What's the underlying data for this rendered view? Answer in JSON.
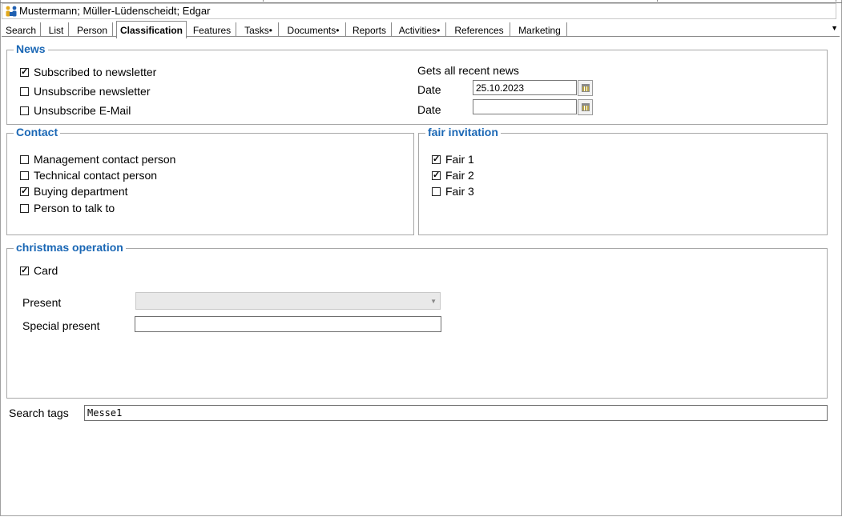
{
  "window": {
    "title": "Mustermann; Müller-Lüdenscheidt; Edgar"
  },
  "tabs": [
    {
      "label": "Search"
    },
    {
      "label": "List"
    },
    {
      "label": "Person"
    },
    {
      "label": "Classification"
    },
    {
      "label": "Features"
    },
    {
      "label": "Tasks•"
    },
    {
      "label": "Documents•"
    },
    {
      "label": "Reports"
    },
    {
      "label": "Activities•"
    },
    {
      "label": "References"
    },
    {
      "label": "Marketing"
    }
  ],
  "active_tab": "Classification",
  "news": {
    "legend": "News",
    "options": [
      {
        "label": "Subscribed to newsletter",
        "checked": true
      },
      {
        "label": "Unsubscribe newsletter",
        "checked": false
      },
      {
        "label": "Unsubscribe E-Mail",
        "checked": false
      }
    ],
    "info_text": "Gets all recent news",
    "date_label_1": "Date",
    "date_value_1": "25.10.2023",
    "date_label_2": "Date",
    "date_value_2": ""
  },
  "contact": {
    "legend": "Contact",
    "options": [
      {
        "label": "Management contact person",
        "checked": false
      },
      {
        "label": "Technical contact person",
        "checked": false
      },
      {
        "label": "Buying department",
        "checked": true
      },
      {
        "label": "Person to talk to",
        "checked": false
      }
    ]
  },
  "fair": {
    "legend": "fair invitation",
    "options": [
      {
        "label": "Fair 1",
        "checked": true
      },
      {
        "label": "Fair 2",
        "checked": true
      },
      {
        "label": "Fair 3",
        "checked": false
      }
    ]
  },
  "christmas": {
    "legend": "christmas operation",
    "card": {
      "label": "Card",
      "checked": true
    },
    "present_label": "Present",
    "present_value": "",
    "special_label": "Special present",
    "special_value": ""
  },
  "search_tags": {
    "label": "Search tags",
    "value": "Messe1"
  },
  "colors": {
    "legend": "#1a67b5",
    "border": "#a8a8a8"
  }
}
